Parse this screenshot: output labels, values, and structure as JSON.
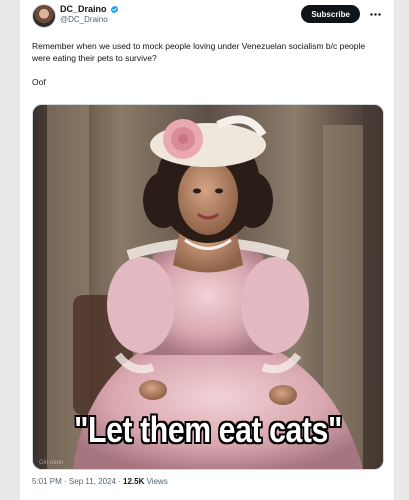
{
  "tweet": {
    "author": {
      "display_name": "DC_Draino",
      "handle": "@DC_Draino",
      "verified": true,
      "verified_color": "#1d9bf0"
    },
    "subscribe_label": "Subscribe",
    "more_icon": "more-horizontal-icon",
    "text_lines": [
      "Remember when we used to mock people loving under Venezuelan socialism b/c people were eating their pets to survive?",
      "Oof"
    ],
    "media": {
      "caption": "\"Let them eat cats\"",
      "watermark": "Gin.neon"
    },
    "meta": {
      "time": "5:01 PM",
      "separator": " · ",
      "date": "Sep 11, 2024",
      "views_count": "12.5K",
      "views_label": " Views"
    }
  }
}
